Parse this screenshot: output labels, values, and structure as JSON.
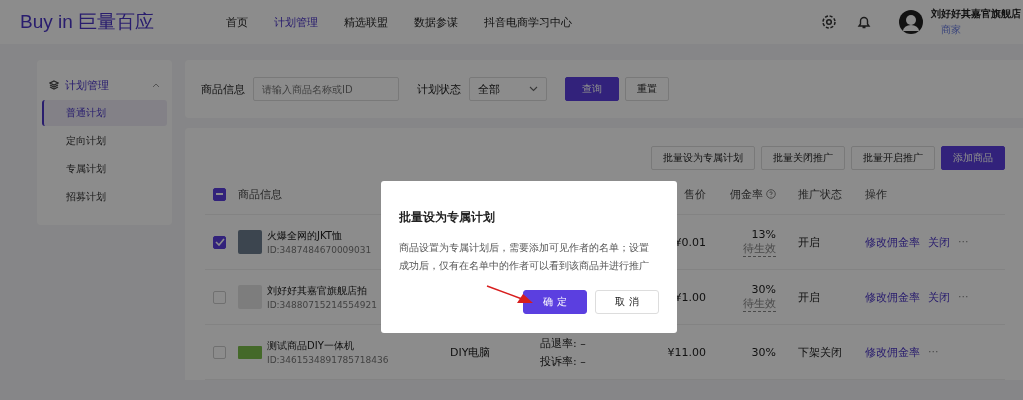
{
  "header": {
    "logo": "Buy in 巨量百应",
    "nav": [
      {
        "label": "首页",
        "selected": false
      },
      {
        "label": "计划管理",
        "selected": true
      },
      {
        "label": "精选联盟",
        "selected": false
      },
      {
        "label": "数据参谋",
        "selected": false
      },
      {
        "label": "抖音电商学习中心",
        "selected": false
      }
    ],
    "user": {
      "name": "刘好好其嘉官旗舰店",
      "role": "商家"
    }
  },
  "sidebar": {
    "group": {
      "label": "计划管理",
      "expanded": true
    },
    "items": [
      {
        "label": "普通计划",
        "selected": true
      },
      {
        "label": "定向计划",
        "selected": false
      },
      {
        "label": "专属计划",
        "selected": false
      },
      {
        "label": "招募计划",
        "selected": false
      }
    ]
  },
  "filters": {
    "product_label": "商品信息",
    "product_placeholder": "请输入商品名称或ID",
    "status_label": "计划状态",
    "status_value": "全部",
    "buttons": [
      {
        "label": "查询",
        "primary": true
      },
      {
        "label": "重置",
        "primary": false
      }
    ]
  },
  "toolbar": [
    {
      "label": "批量设为专属计划",
      "primary": false
    },
    {
      "label": "批量关闭推广",
      "primary": false
    },
    {
      "label": "批量开启推广",
      "primary": false
    },
    {
      "label": "添加商品",
      "primary": true
    }
  ],
  "table": {
    "select_all": {
      "partial": true
    },
    "columns": [
      "商品信息",
      "售价",
      "佣金率",
      "推广状态",
      "操作"
    ],
    "rows": [
      {
        "checked": true,
        "thumb": {
          "kind": "photo"
        },
        "name": "火爆全网的JKT恤",
        "id": "ID:3487484670009031",
        "category": "",
        "rates": [],
        "price": "¥0.01",
        "commission": "13%",
        "pending": "待生效",
        "status": "开启",
        "actions": [
          "修改佣金率",
          "关闭",
          "···"
        ]
      },
      {
        "checked": false,
        "thumb": {
          "kind": "placeholder"
        },
        "name": "刘好好其嘉官旗舰店拍",
        "id": "ID:34880715214554921",
        "category": "",
        "rates": [],
        "price": "¥1.00",
        "commission": "30%",
        "pending": "待生效",
        "status": "开启",
        "actions": [
          "修改佣金率",
          "关闭",
          "···"
        ]
      },
      {
        "checked": false,
        "thumb": {
          "kind": "card"
        },
        "name": "测试商品DIY一体机",
        "id": "ID:3461534891785718436",
        "category": "DIY电脑",
        "rates": [
          "品退率: –",
          "投诉率: –"
        ],
        "price": "¥11.00",
        "commission": "30%",
        "pending": "",
        "status": "下架关闭",
        "actions": [
          "修改佣金率",
          "···"
        ]
      }
    ]
  },
  "dialog": {
    "title": "批量设为专属计划",
    "body": "商品设置为专属计划后，需要添加可见作者的名单；设置成功后，仅有在名单中的作者可以看到该商品并进行推广",
    "buttons": [
      {
        "label": "确 定",
        "primary": true
      },
      {
        "label": "取 消",
        "primary": false
      }
    ]
  }
}
